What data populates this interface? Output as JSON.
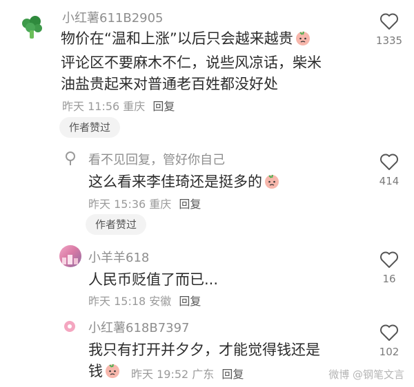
{
  "comments": [
    {
      "username": "小红薯611B2905",
      "lines": [
        "物价在“温和上涨”以后只会越来越贵",
        "评论区不要麻木不仁，说些风凉话，柴米",
        "油盐贵起来对普通老百姓都没好处"
      ],
      "time": "昨天 11:56",
      "location": "重庆",
      "reply_label": "回复",
      "badge": "作者赞过",
      "likes": "1335",
      "avatar_icon": "broccoli-icon"
    },
    {
      "username": "看不见回复，管好你自己",
      "lines": [
        "这么看来李佳琦还是挺多的"
      ],
      "time": "昨天 15:36",
      "location": "重庆",
      "reply_label": "回复",
      "badge": "作者赞过",
      "likes": "414",
      "avatar_icon": "pin-icon"
    },
    {
      "username": "小羊羊618",
      "lines": [
        "人民币贬值了而已..."
      ],
      "time": "昨天 15:18",
      "location": "安徽",
      "reply_label": "回复",
      "likes": "16",
      "avatar_icon": "photo-avatar"
    },
    {
      "username": "小红薯618B7397",
      "lines": [
        "我只有打开并夕夕，才能觉得钱还是",
        "钱"
      ],
      "time": "昨天 19:52",
      "location": "广东",
      "reply_label": "回复",
      "likes": "102",
      "avatar_icon": "donut-icon"
    }
  ],
  "watermark": "微博 @钢笔文言",
  "colors": {
    "username": "#8e8e8e",
    "badge_bg": "#f3f3f3",
    "emoji": "#f4a9a0"
  }
}
